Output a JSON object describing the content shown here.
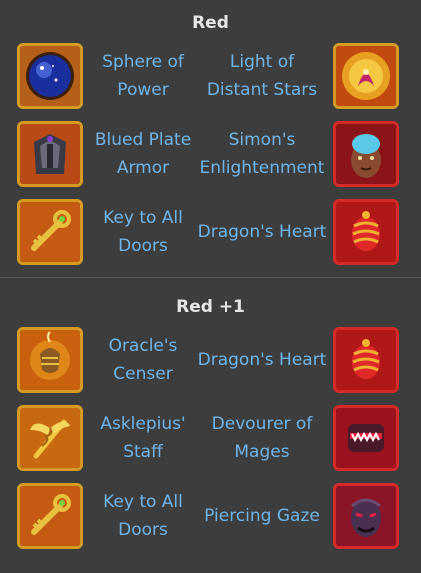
{
  "sections": [
    {
      "title": "Red",
      "rows": [
        {
          "left": "Sphere of Power",
          "right": "Light of Distant Stars",
          "left_icon": "sphere-of-power-icon",
          "right_icon": "light-of-distant-stars-icon"
        },
        {
          "left": "Blued Plate Armor",
          "right": "Simon's Enlightenment",
          "left_icon": "blued-plate-armor-icon",
          "right_icon": "simons-enlightenment-icon"
        },
        {
          "left": "Key to All Doors",
          "right": "Dragon's Heart",
          "left_icon": "key-to-all-doors-icon",
          "right_icon": "dragons-heart-icon"
        }
      ]
    },
    {
      "title": "Red +1",
      "rows": [
        {
          "left": "Oracle's Censer",
          "right": "Dragon's Heart",
          "left_icon": "oracles-censer-icon",
          "right_icon": "dragons-heart-icon"
        },
        {
          "left": "Asklepius' Staff",
          "right": "Devourer of Mages",
          "left_icon": "asklepius-staff-icon",
          "right_icon": "devourer-of-mages-icon"
        },
        {
          "left": "Key to All Doors",
          "right": "Piercing Gaze",
          "left_icon": "key-to-all-doors-icon",
          "right_icon": "piercing-gaze-icon"
        }
      ]
    }
  ],
  "colors": {
    "background": "#3d3d3d",
    "title": "#e6e6e6",
    "item_name": "#6fb4e8",
    "frame_gold": "#d49a22",
    "frame_ruby": "#d42a2a"
  }
}
